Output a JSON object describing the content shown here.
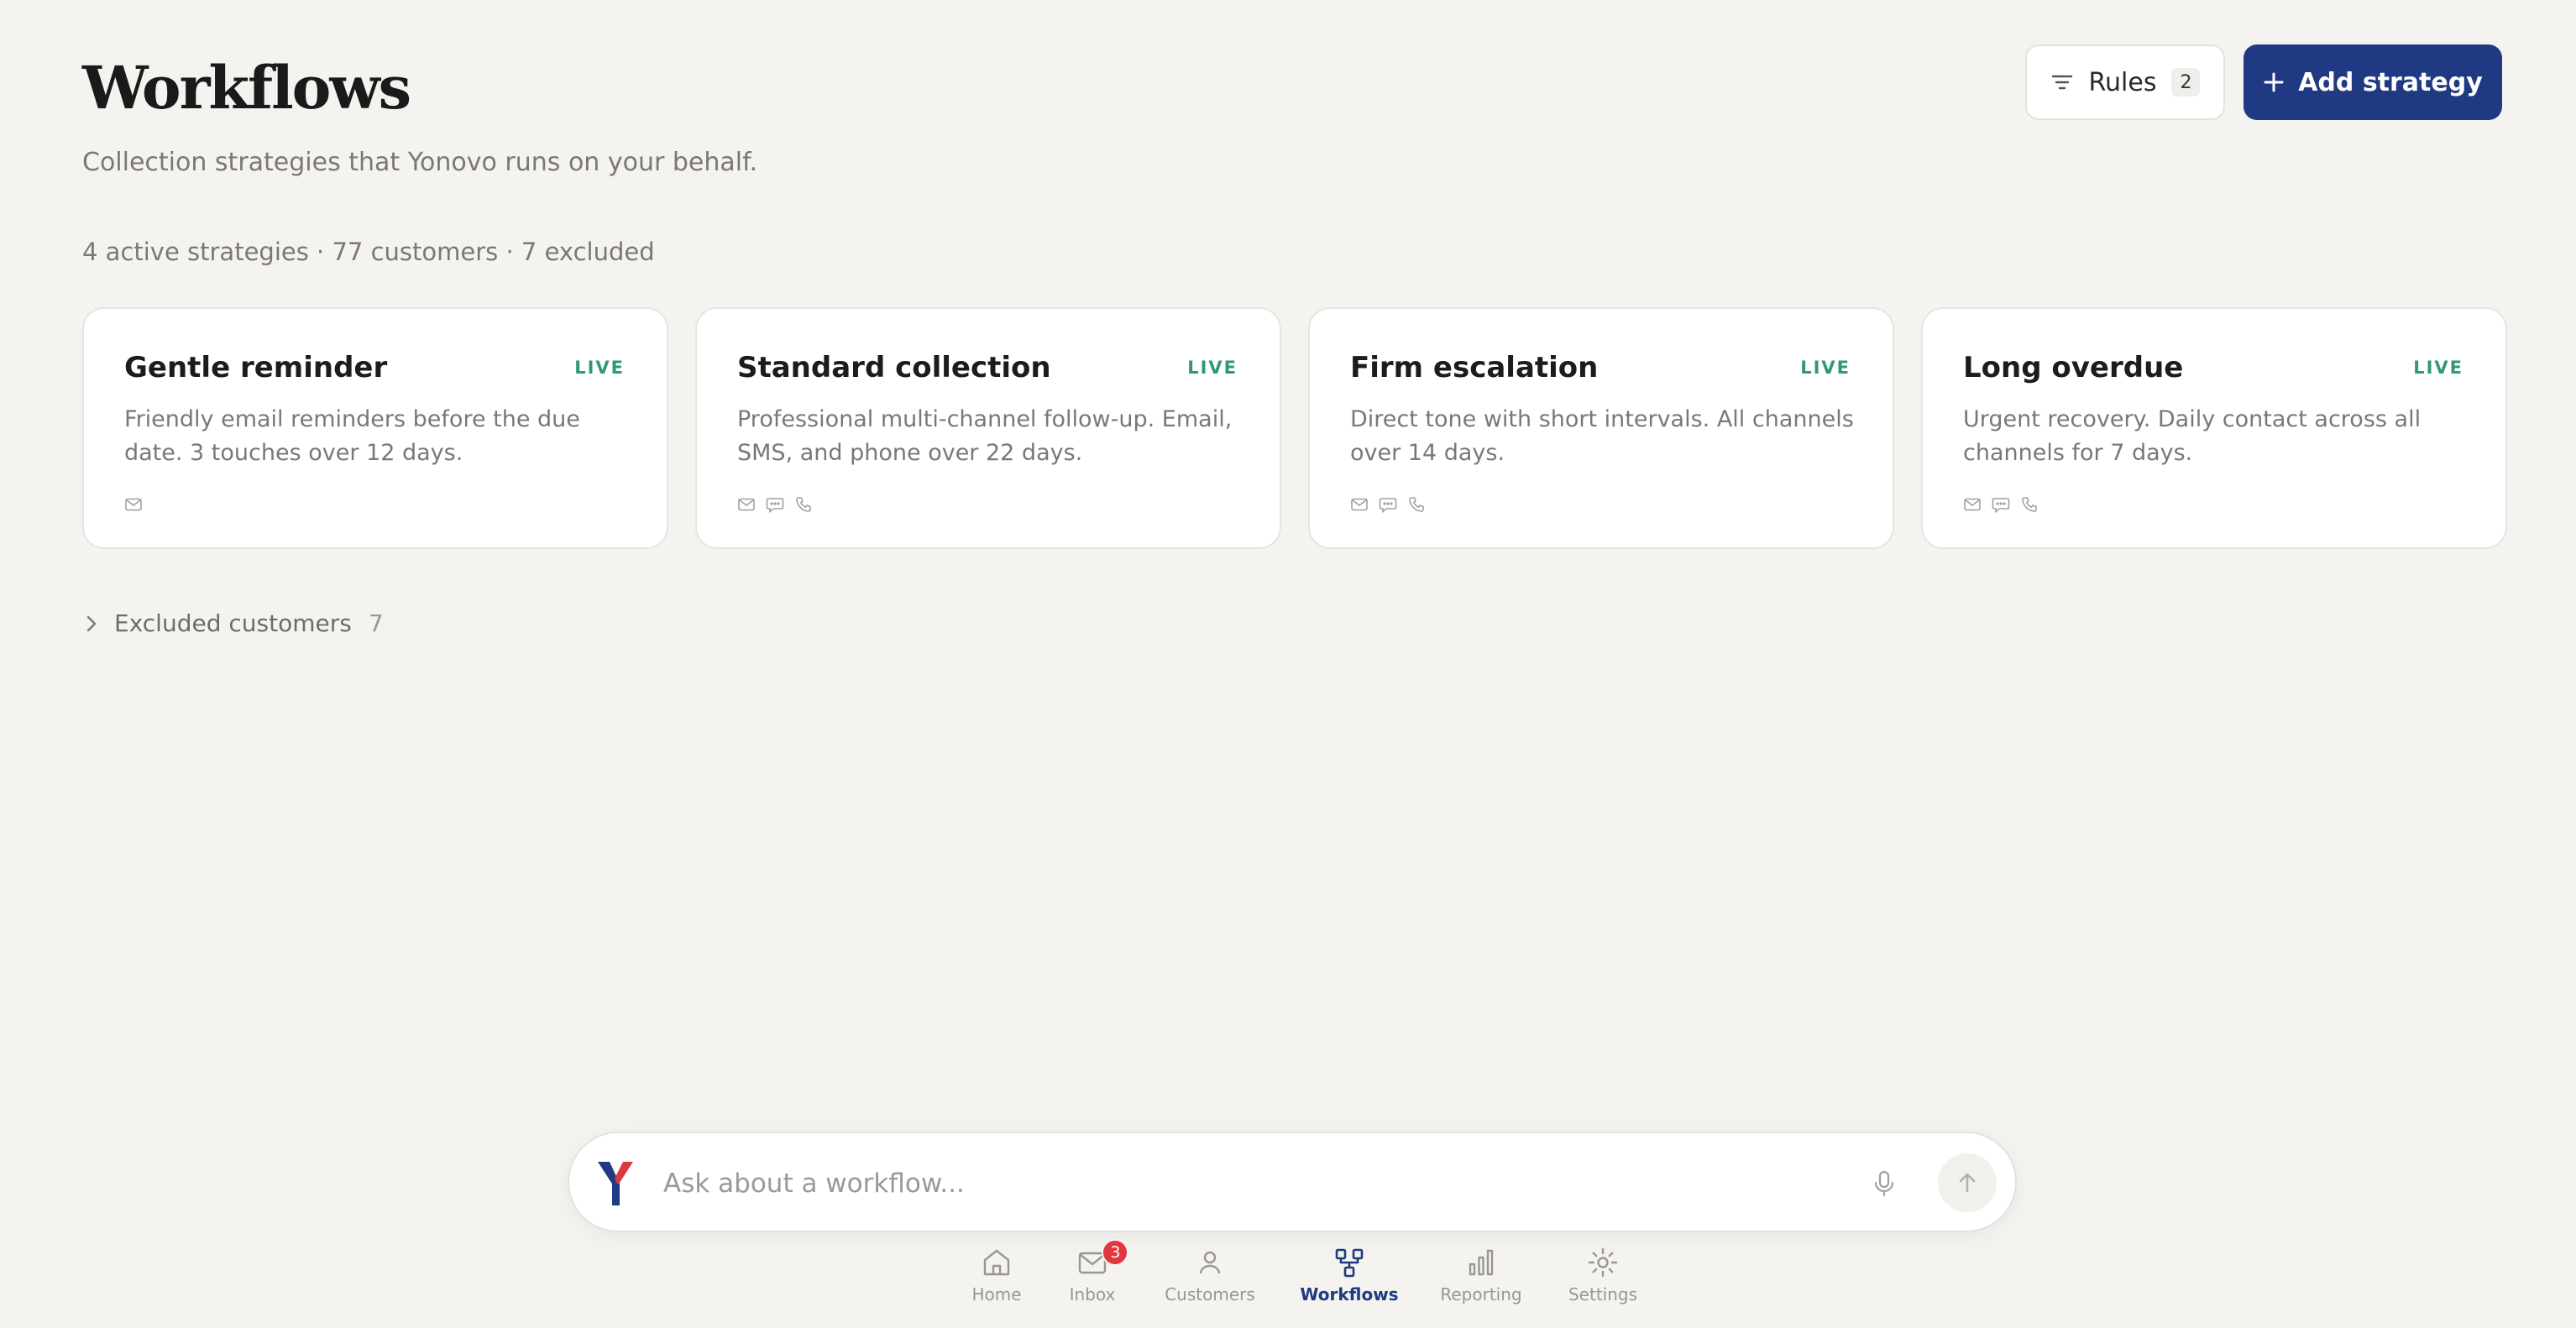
{
  "header": {
    "title": "Workflows",
    "subtitle": "Collection strategies that Yonovo runs on your behalf.",
    "summary": "4 active strategies · 77 customers · 7 excluded",
    "rules_label": "Rules",
    "rules_count": "2",
    "add_label": "Add strategy"
  },
  "strategies": [
    {
      "title": "Gentle reminder",
      "status": "LIVE",
      "description": "Friendly email reminders before the due date. 3 touches over 12 days.",
      "channels": [
        "mail-icon"
      ]
    },
    {
      "title": "Standard collection",
      "status": "LIVE",
      "description": "Professional multi-channel follow-up. Email, SMS, and phone over 22 days.",
      "channels": [
        "mail-icon",
        "sms-icon",
        "phone-icon"
      ]
    },
    {
      "title": "Firm escalation",
      "status": "LIVE",
      "description": "Direct tone with short intervals. All channels over 14 days.",
      "channels": [
        "mail-icon",
        "sms-icon",
        "phone-icon"
      ]
    },
    {
      "title": "Long overdue",
      "status": "LIVE",
      "description": "Urgent recovery. Daily contact across all channels for 7 days.",
      "channels": [
        "mail-icon",
        "sms-icon",
        "phone-icon"
      ]
    }
  ],
  "excluded": {
    "label": "Excluded customers",
    "count": "7"
  },
  "chat": {
    "placeholder": "Ask about a workflow..."
  },
  "nav": {
    "items": [
      {
        "label": "Home",
        "icon": "home-icon"
      },
      {
        "label": "Inbox",
        "icon": "inbox-icon",
        "badge": "3"
      },
      {
        "label": "Customers",
        "icon": "user-icon"
      },
      {
        "label": "Workflows",
        "icon": "workflow-icon",
        "active": true
      },
      {
        "label": "Reporting",
        "icon": "bar-chart-icon"
      },
      {
        "label": "Settings",
        "icon": "gear-icon"
      }
    ]
  },
  "colors": {
    "accent": "#1f3a82",
    "live": "#2f9a72",
    "badge": "#e0383e",
    "background": "#f4f3f0"
  }
}
